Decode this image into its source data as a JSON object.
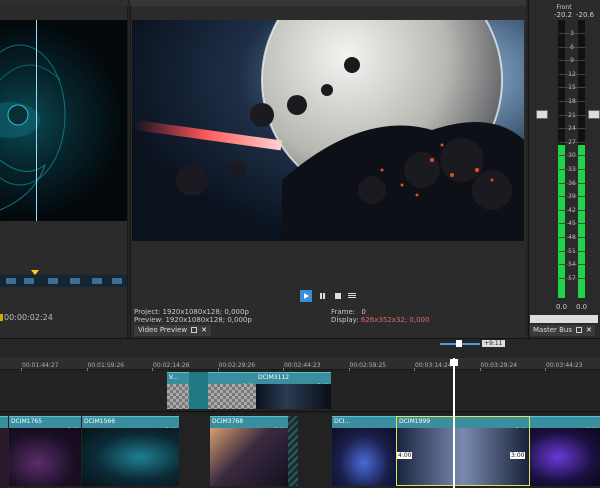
{
  "trimmer": {
    "timecode": "00:00:02:24"
  },
  "preview": {
    "info_left": {
      "project_label": "Project:",
      "project_value": "1920x1080x128; 0,000p",
      "preview_label": "Preview:",
      "preview_value": "1920x1080x128; 0,000p",
      "display_label": "Display:",
      "display_value": "626x352x32; 0,000"
    },
    "info_right": {
      "frame_label": "Frame:",
      "frame_value": "0",
      "display_label": "Display:",
      "display_value": "626x352x32; 0,000"
    },
    "tab_label": "Video Preview"
  },
  "master": {
    "label": "Front",
    "peak_left": "-20.2",
    "peak_right": "-20.6",
    "scale": [
      "3",
      "6",
      "9",
      "12",
      "15",
      "18",
      "21",
      "24",
      "27",
      "30",
      "33",
      "36",
      "39",
      "42",
      "45",
      "48",
      "51",
      "54",
      "57"
    ],
    "level_left": 0.55,
    "level_right": 0.55,
    "value_left": "0.0",
    "value_right": "0.0",
    "tab_label": "Master Bus"
  },
  "timeline": {
    "zoom_label": "+9:11",
    "ruler": [
      "00:01:44:27",
      "00:01:59:26",
      "00:02:14:26",
      "00:02:29:26",
      "00:02:44:23",
      "00:02:59:25",
      "00:03:14:24",
      "00:03:29:24",
      "00:03:44:23"
    ],
    "track1_clips": [
      {
        "name": "V...",
        "type": "checker"
      },
      {
        "name": "",
        "type": "checker"
      },
      {
        "name": "DCIM3112",
        "type": "dark"
      }
    ],
    "track2_clips": [
      {
        "name": "DCIM1765"
      },
      {
        "name": "DCIM1566"
      },
      {
        "name": "DCIM3768"
      },
      {
        "name": "DCI..."
      },
      {
        "name": "DCIM1999"
      },
      {
        "name": ""
      }
    ],
    "fade_tags": [
      "4:00",
      "3:00"
    ]
  },
  "colors": {
    "accent": "#3a8ed6",
    "clip_header": "#3b8e9e",
    "meter_green": "#1fd34b"
  }
}
